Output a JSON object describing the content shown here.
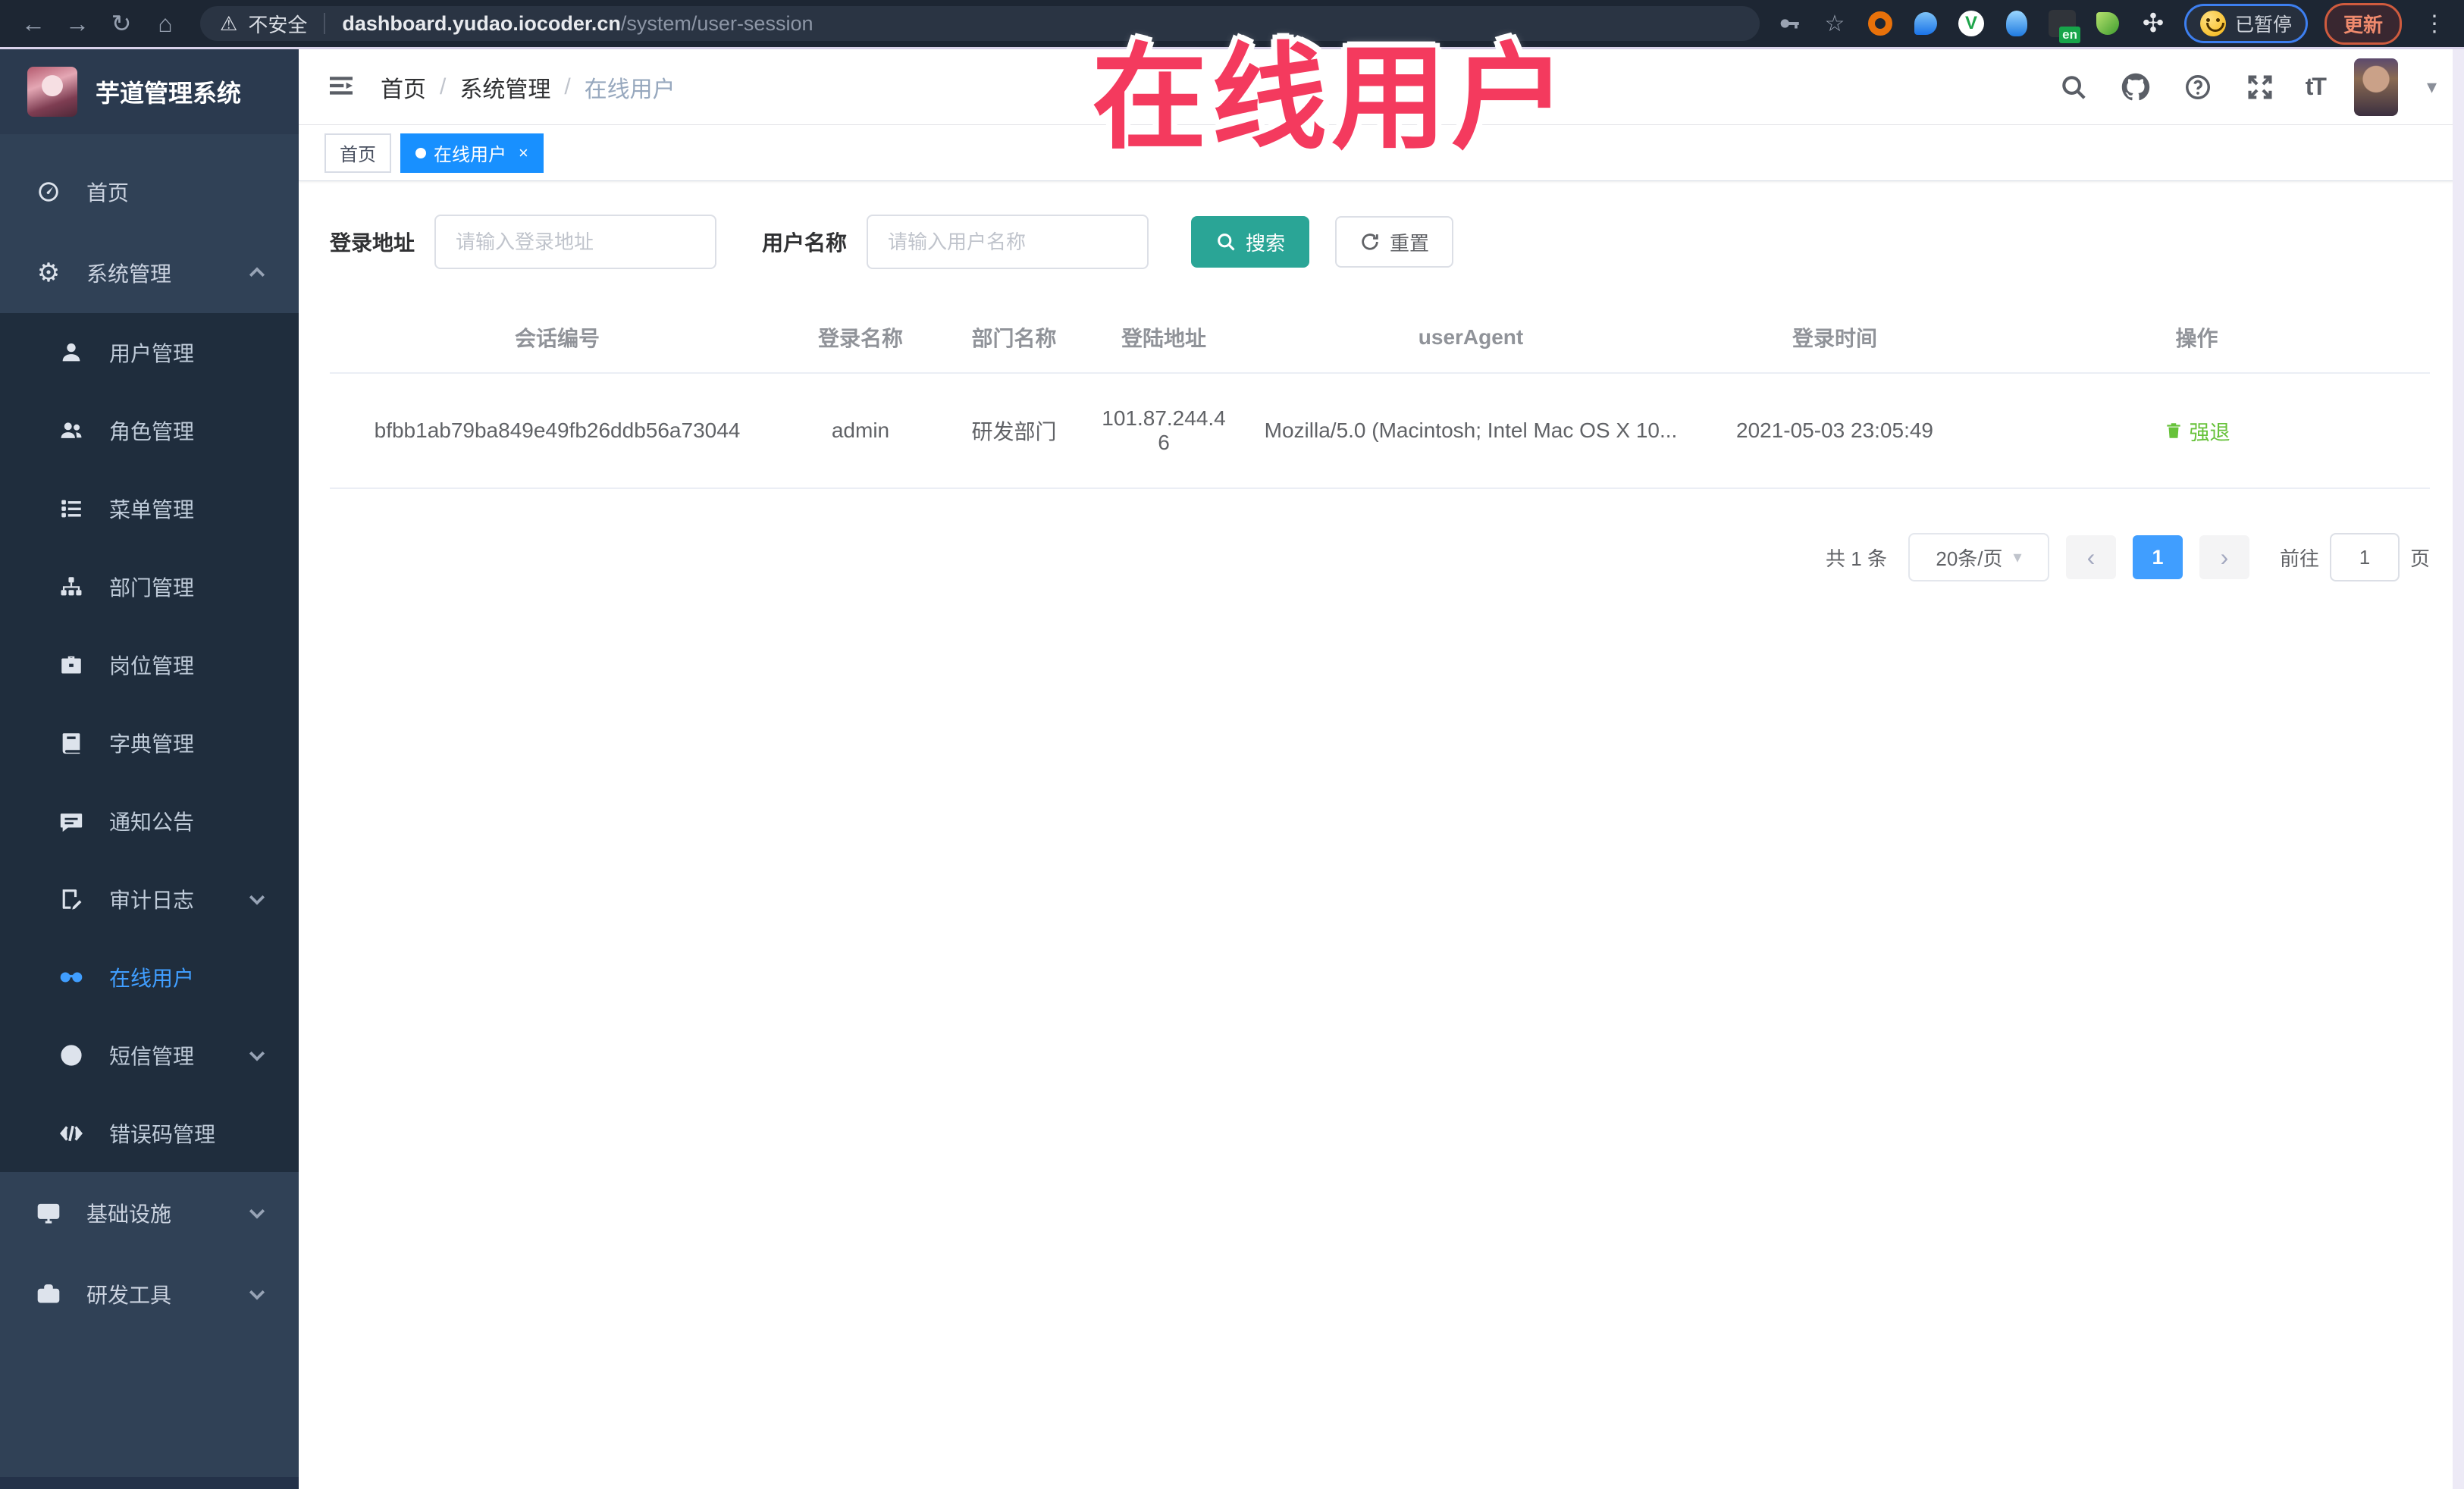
{
  "browser": {
    "back_glyph": "←",
    "forward_glyph": "→",
    "reload_glyph": "↻",
    "home_glyph": "⌂",
    "warning_glyph": "⚠",
    "security_label": "不安全",
    "url_domain": "dashboard.yudao.iocoder.cn",
    "url_path": "/system/user-session",
    "star_glyph": "☆",
    "pinwheel_glyph": "✣",
    "extension_badge": "en",
    "green_circle_letter": "V",
    "paused_label": "已暂停",
    "update_label": "更新",
    "kebab_glyph": "⋮"
  },
  "overlay": {
    "text": "在线用户",
    "color": "#f43a5e"
  },
  "sidebar": {
    "title": "芋道管理系统",
    "items": [
      {
        "label": "首页",
        "icon": "dashboard-icon",
        "level": 1
      },
      {
        "label": "系统管理",
        "icon": "gear-icon",
        "level": 1,
        "chevron": "up"
      },
      {
        "label": "用户管理",
        "icon": "user-icon",
        "level": 2
      },
      {
        "label": "角色管理",
        "icon": "roles-icon",
        "level": 2
      },
      {
        "label": "菜单管理",
        "icon": "menu-list-icon",
        "level": 2
      },
      {
        "label": "部门管理",
        "icon": "org-tree-icon",
        "level": 2
      },
      {
        "label": "岗位管理",
        "icon": "briefcase-icon",
        "level": 2
      },
      {
        "label": "字典管理",
        "icon": "dictionary-icon",
        "level": 2
      },
      {
        "label": "通知公告",
        "icon": "announcement-icon",
        "level": 2
      },
      {
        "label": "审计日志",
        "icon": "audit-log-icon",
        "level": 2,
        "chevron": "down"
      },
      {
        "label": "在线用户",
        "icon": "online-users-icon",
        "level": 2,
        "active": true
      },
      {
        "label": "短信管理",
        "icon": "sms-icon",
        "level": 2,
        "chevron": "down"
      },
      {
        "label": "错误码管理",
        "icon": "error-code-icon",
        "level": 2
      },
      {
        "label": "基础设施",
        "icon": "infrastructure-icon",
        "level": 1,
        "chevron": "down"
      },
      {
        "label": "研发工具",
        "icon": "dev-tools-icon",
        "level": 1,
        "chevron": "down"
      }
    ],
    "gear_glyph": "⚙"
  },
  "header": {
    "breadcrumb": [
      "首页",
      "系统管理",
      "在线用户"
    ],
    "separator": "/",
    "font_size_icon_text": "tT",
    "caret_glyph": "▾"
  },
  "tabs": [
    {
      "label": "首页",
      "active": false
    },
    {
      "label": "在线用户",
      "active": true,
      "close_glyph": "×"
    }
  ],
  "filters": {
    "login_address_label": "登录地址",
    "login_address_placeholder": "请输入登录地址",
    "username_label": "用户名称",
    "username_placeholder": "请输入用户名称",
    "search_label": "搜索",
    "reset_label": "重置"
  },
  "table": {
    "columns": [
      "会话编号",
      "登录名称",
      "部门名称",
      "登陆地址",
      "userAgent",
      "登录时间",
      "操作"
    ],
    "rows": [
      {
        "session_id": "bfbb1ab79ba849e49fb26ddb56a73044",
        "login_name": "admin",
        "dept_name": "研发部门",
        "login_address": "101.87.244.46",
        "user_agent": "Mozilla/5.0 (Macintosh; Intel Mac OS X 10...",
        "login_time": "2021-05-03 23:05:49",
        "action_label": "强退"
      }
    ]
  },
  "pagination": {
    "total_label": "共 1 条",
    "page_size_label": "20条/页",
    "prev_glyph": "‹",
    "next_glyph": "›",
    "current_page": "1",
    "goto_label": "前往",
    "goto_value": "1",
    "page_suffix": "页"
  },
  "colors": {
    "accent_blue": "#409eff",
    "tab_active_blue": "#1890ff",
    "search_teal": "#2aa596",
    "action_green": "#67c23a",
    "sidebar_bg": "#304156",
    "submenu_bg": "#1f2d3d",
    "annotation_red": "#f43a5e"
  }
}
